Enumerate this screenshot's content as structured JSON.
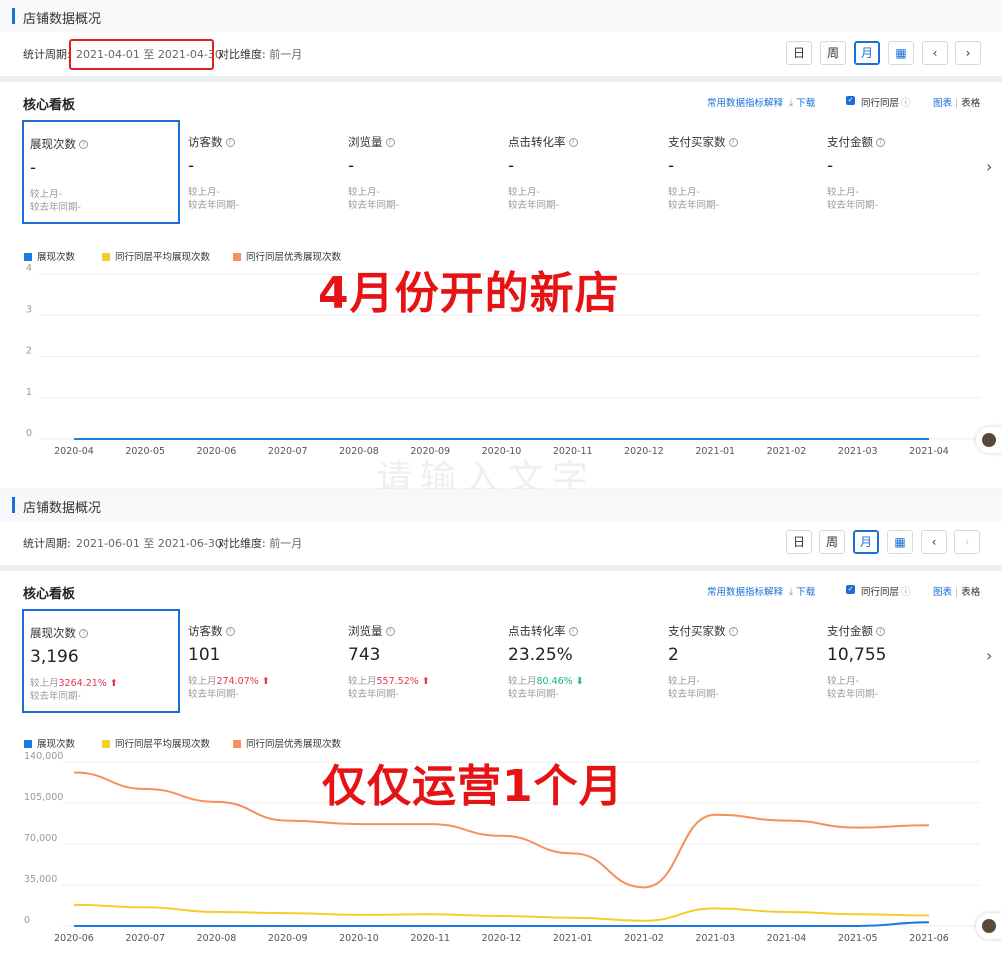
{
  "panels": [
    {
      "section_title": "店铺数据概况",
      "period_label": "统计周期:",
      "period_range": "2021-04-01 至 2021-04-30",
      "compare_label": "对比维度:",
      "compare_value": "前一月",
      "buttons": {
        "day": "日",
        "week": "周",
        "month": "月"
      },
      "board_title": "核心看板",
      "links": "常用数据指标解释",
      "download": "下载",
      "peer": "同行同层",
      "view_chart": "图表",
      "view_sep": "|",
      "view_table": "表格",
      "metrics": [
        {
          "name": "展现次数",
          "value": "-",
          "l1": "较上月-",
          "l2": "较去年同期-"
        },
        {
          "name": "访客数",
          "value": "-",
          "l1": "较上月-",
          "l2": "较去年同期-"
        },
        {
          "name": "浏览量",
          "value": "-",
          "l1": "较上月-",
          "l2": "较去年同期-"
        },
        {
          "name": "点击转化率",
          "value": "-",
          "l1": "较上月-",
          "l2": "较去年同期-"
        },
        {
          "name": "支付买家数",
          "value": "-",
          "l1": "较上月-",
          "l2": "较去年同期-"
        },
        {
          "name": "支付金额",
          "value": "-",
          "l1": "较上月-",
          "l2": "较去年同期-"
        }
      ],
      "legend": [
        "展现次数",
        "同行同层平均展现次数",
        "同行同层优秀展现次数"
      ],
      "overlay_text": "4月份开的新店"
    },
    {
      "section_title": "店铺数据概况",
      "period_label": "统计周期:",
      "period_range": "2021-06-01 至 2021-06-30",
      "compare_label": "对比维度:",
      "compare_value": "前一月",
      "buttons": {
        "day": "日",
        "week": "周",
        "month": "月"
      },
      "board_title": "核心看板",
      "links": "常用数据指标解释",
      "download": "下载",
      "peer": "同行同层",
      "view_chart": "图表",
      "view_sep": "|",
      "view_table": "表格",
      "metrics": [
        {
          "name": "展现次数",
          "value": "3,196",
          "l1_prefix": "较上月",
          "l1_change": "3264.21%",
          "dir": "up",
          "l2": "较去年同期-"
        },
        {
          "name": "访客数",
          "value": "101",
          "l1_prefix": "较上月",
          "l1_change": "274.07%",
          "dir": "up",
          "l2": "较去年同期-"
        },
        {
          "name": "浏览量",
          "value": "743",
          "l1_prefix": "较上月",
          "l1_change": "557.52%",
          "dir": "up",
          "l2": "较去年同期-"
        },
        {
          "name": "点击转化率",
          "value": "23.25%",
          "l1_prefix": "较上月",
          "l1_change": "80.46%",
          "dir": "down",
          "l2": "较去年同期-"
        },
        {
          "name": "支付买家数",
          "value": "2",
          "l1": "较上月-",
          "l2": "较去年同期-"
        },
        {
          "name": "支付金额",
          "value": "10,755",
          "l1": "较上月-",
          "l2": "较去年同期-"
        }
      ],
      "legend": [
        "展现次数",
        "同行同层平均展现次数",
        "同行同层优秀展现次数"
      ],
      "overlay_text": "仅仅运营1个月"
    }
  ],
  "watermark": "请输入文字",
  "colors": {
    "accent": "#1a6fd6",
    "series_blue": "#1a7ce0",
    "series_yellow": "#f5cd2a",
    "series_orange": "#f5915a",
    "red": "#e51313",
    "up": "#e8344e",
    "down": "#14b884"
  },
  "chart_data": [
    {
      "type": "line",
      "categories": [
        "2020-04",
        "2020-05",
        "2020-06",
        "2020-07",
        "2020-08",
        "2020-09",
        "2020-10",
        "2020-11",
        "2020-12",
        "2021-01",
        "2021-02",
        "2021-03",
        "2021-04"
      ],
      "y_ticks": [
        "4",
        "3",
        "2",
        "1",
        "0"
      ],
      "ylim": [
        0,
        4
      ],
      "series": [
        {
          "name": "展现次数",
          "values": [
            0,
            0,
            0,
            0,
            0,
            0,
            0,
            0,
            0,
            0,
            0,
            0,
            0
          ]
        }
      ]
    },
    {
      "type": "line",
      "categories": [
        "2020-06",
        "2020-07",
        "2020-08",
        "2020-09",
        "2020-10",
        "2020-11",
        "2020-12",
        "2021-01",
        "2021-02",
        "2021-03",
        "2021-04",
        "2021-05",
        "2021-06"
      ],
      "y_ticks": [
        "140,000",
        "105,000",
        "70,000",
        "35,000",
        "0"
      ],
      "ylim": [
        0,
        140000
      ],
      "series": [
        {
          "name": "展现次数",
          "values": [
            0,
            0,
            0,
            0,
            0,
            0,
            0,
            0,
            0,
            0,
            0,
            0,
            3196
          ]
        },
        {
          "name": "同行同层平均展现次数",
          "values": [
            18000,
            16000,
            12000,
            11000,
            9500,
            10000,
            8500,
            7000,
            4500,
            15000,
            12000,
            10000,
            9000
          ]
        },
        {
          "name": "同行同层优秀展现次数",
          "values": [
            131000,
            117000,
            106000,
            90000,
            87000,
            87000,
            77000,
            62000,
            33000,
            95000,
            90000,
            84000,
            86000
          ]
        }
      ]
    }
  ]
}
